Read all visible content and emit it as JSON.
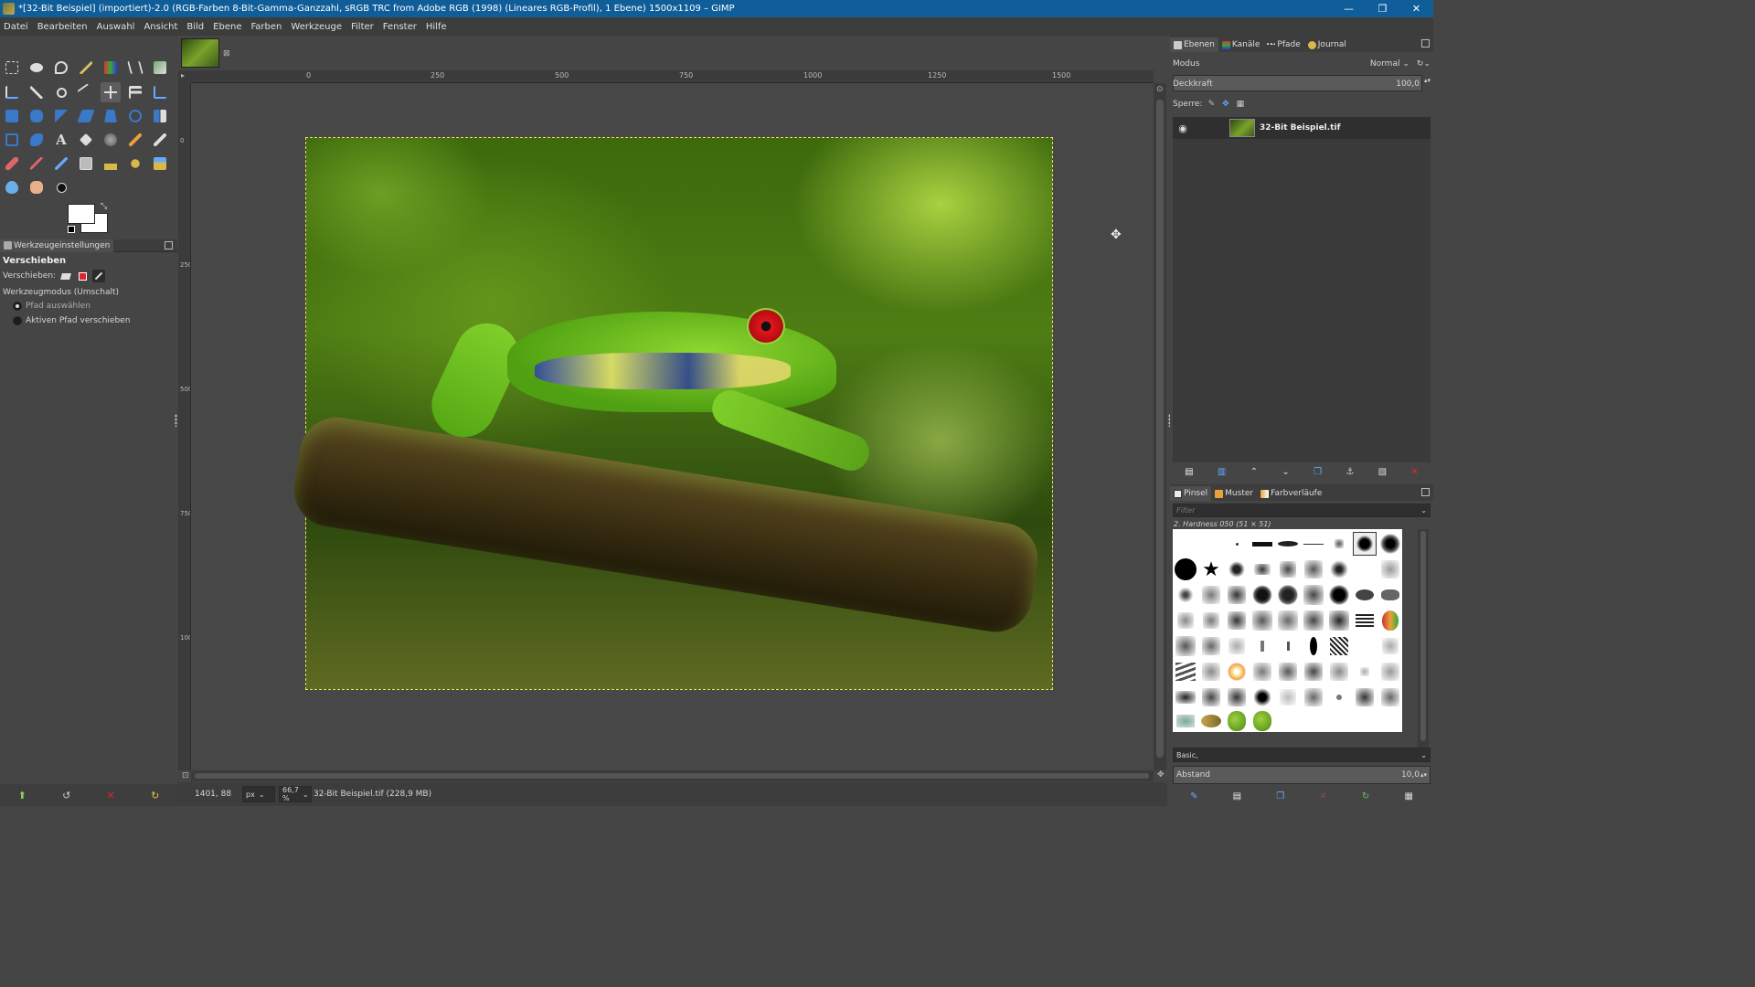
{
  "window": {
    "title": "*[32-Bit Beispiel] (importiert)-2.0 (RGB-Farben 8-Bit-Gamma-Ganzzahl, sRGB TRC from Adobe RGB (1998) (Lineares RGB-Profil), 1 Ebene) 1500x1109 – GIMP",
    "minimize": "—",
    "restore": "❐",
    "close": "✕"
  },
  "menu": [
    "Datei",
    "Bearbeiten",
    "Auswahl",
    "Ansicht",
    "Bild",
    "Ebene",
    "Farben",
    "Werkzeuge",
    "Filter",
    "Fenster",
    "Hilfe"
  ],
  "tool_options": {
    "tab_label": "Werkzeugeinstellungen",
    "tool_name": "Verschieben",
    "move_label": "Verschieben:",
    "mode_label": "Werkzeugmodus (Umschalt)",
    "radio_1": "Pfad auswählen",
    "radio_2": "Aktiven Pfad verschieben"
  },
  "rulers": {
    "h_labels": [
      "0",
      "250",
      "500",
      "750",
      "1000",
      "1250",
      "1500"
    ],
    "v_labels": [
      "0",
      "250",
      "500",
      "750",
      "1000"
    ]
  },
  "status": {
    "coords": "1401, 88",
    "unit": "px",
    "zoom": "66,7 %",
    "file_info": "32-Bit Beispiel.tif (228,9 MB)"
  },
  "layers_panel": {
    "tabs": [
      "Ebenen",
      "Kanäle",
      "Pfade",
      "Journal"
    ],
    "mode_label": "Modus",
    "mode_value": "Normal",
    "opacity_label": "Deckkraft",
    "opacity_value": "100,0",
    "lock_label": "Sperre:",
    "layer_name": "32-Bit Beispiel.tif"
  },
  "brushes_panel": {
    "tabs": [
      "Pinsel",
      "Muster",
      "Farbverläufe"
    ],
    "filter_placeholder": "Filter",
    "brush_name": "2. Hardness 050 (51 × 51)",
    "preset": "Basic,",
    "spacing_label": "Abstand",
    "spacing_value": "10,0"
  },
  "colors": {
    "titlebar": "#0f5d99",
    "selection": "#e8e84a",
    "delete_red": "#e0262a"
  }
}
